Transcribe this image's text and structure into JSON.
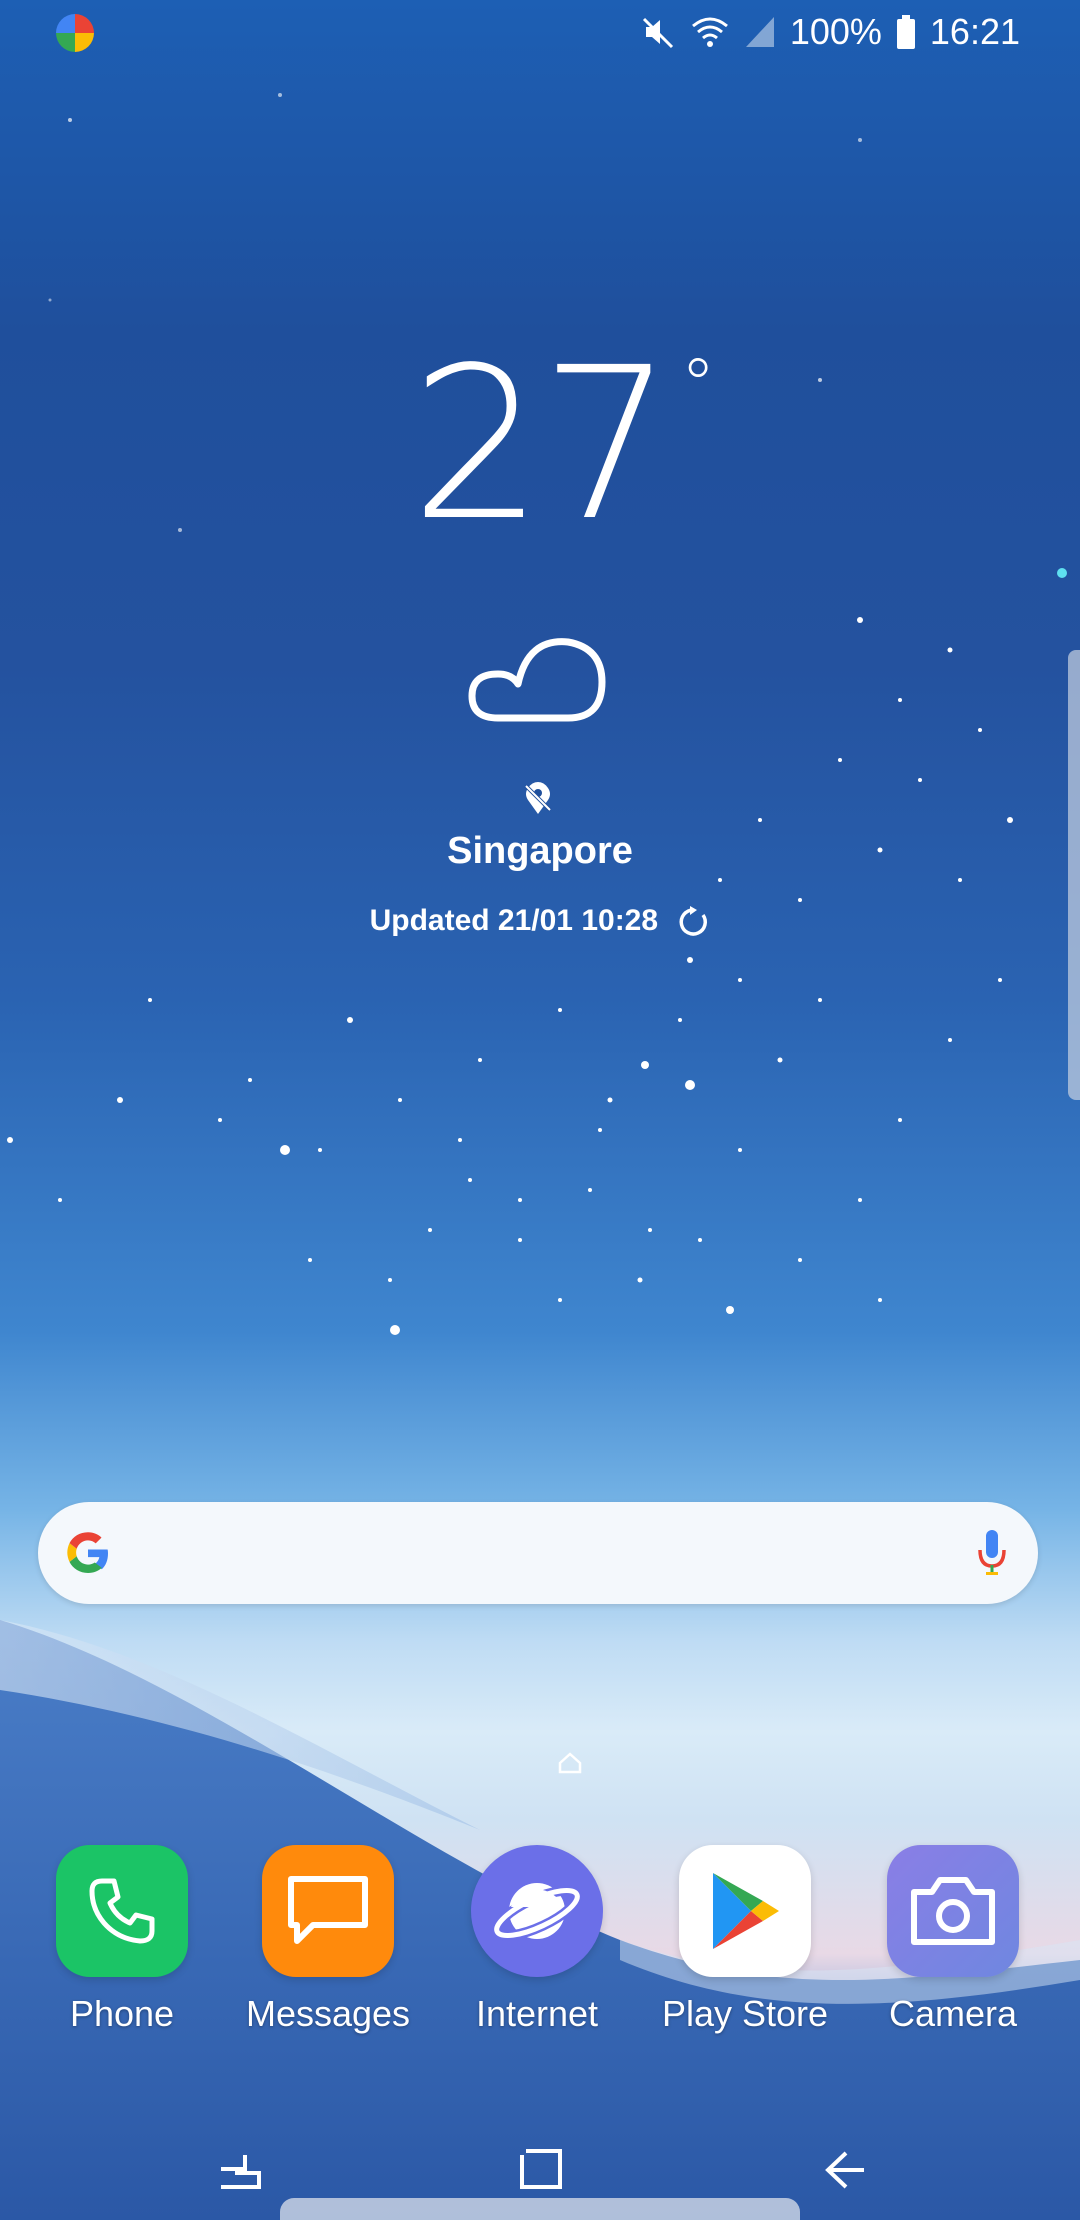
{
  "status_bar": {
    "battery_text": "100%",
    "time": "16:21",
    "icons": [
      "app-notification-icon",
      "mute-icon",
      "wifi-icon",
      "signal-icon",
      "battery-icon"
    ]
  },
  "weather": {
    "temperature": "27",
    "degree_symbol": "°",
    "condition_icon": "cloud-icon",
    "city": "Singapore",
    "updated": "Updated 21/01 10:28"
  },
  "search": {
    "placeholder": "",
    "icons": [
      "google-g-icon",
      "mic-icon"
    ]
  },
  "dock": {
    "apps": [
      {
        "label": "Phone",
        "icon": "phone-icon",
        "color": "#1bc466"
      },
      {
        "label": "Messages",
        "icon": "messages-icon",
        "color": "#ff8a0c"
      },
      {
        "label": "Internet",
        "icon": "internet-icon",
        "color": "#6b6fe8"
      },
      {
        "label": "Play Store",
        "icon": "play-store-icon",
        "color": "#ffffff"
      },
      {
        "label": "Camera",
        "icon": "camera-icon",
        "color": "#7a7fe6"
      }
    ]
  },
  "nav_bar": {
    "buttons": [
      "recents-button",
      "home-button",
      "back-button"
    ]
  }
}
